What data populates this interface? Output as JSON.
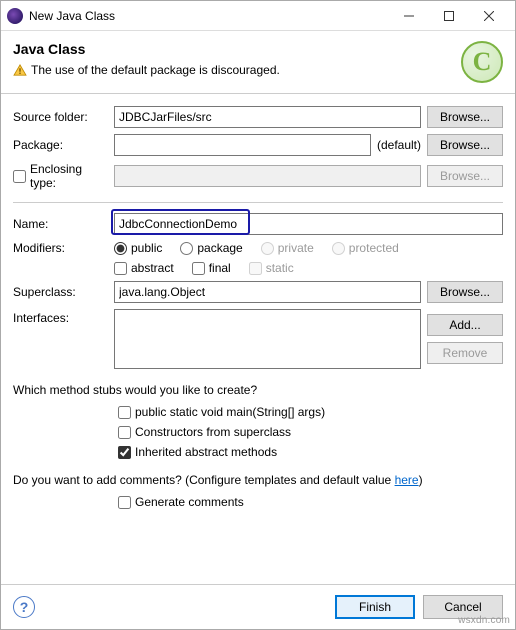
{
  "window": {
    "title": "New Java Class"
  },
  "header": {
    "title": "Java Class",
    "warning": "The use of the default package is discouraged."
  },
  "labels": {
    "sourceFolder": "Source folder:",
    "package": "Package:",
    "enclosingType": "Enclosing type:",
    "name": "Name:",
    "modifiers": "Modifiers:",
    "superclass": "Superclass:",
    "interfaces": "Interfaces:",
    "defaultSuffix": "(default)"
  },
  "values": {
    "sourceFolder": "JDBCJarFiles/src",
    "package": "",
    "enclosingType": "",
    "name": "JdbcConnectionDemo",
    "superclass": "java.lang.Object"
  },
  "modifiers": {
    "public": "public",
    "package": "package",
    "private": "private",
    "protected": "protected",
    "abstract": "abstract",
    "final": "final",
    "static": "static"
  },
  "buttons": {
    "browse": "Browse...",
    "add": "Add...",
    "remove": "Remove",
    "finish": "Finish",
    "cancel": "Cancel"
  },
  "stubs": {
    "question": "Which method stubs would you like to create?",
    "main": "public static void main(String[] args)",
    "superConstructors": "Constructors from superclass",
    "inherited": "Inherited abstract methods"
  },
  "comments": {
    "question_prefix": "Do you want to add comments? (Configure templates and default value ",
    "here": "here",
    "question_suffix": ")",
    "generate": "Generate comments"
  },
  "watermark": "wsxdn.com"
}
